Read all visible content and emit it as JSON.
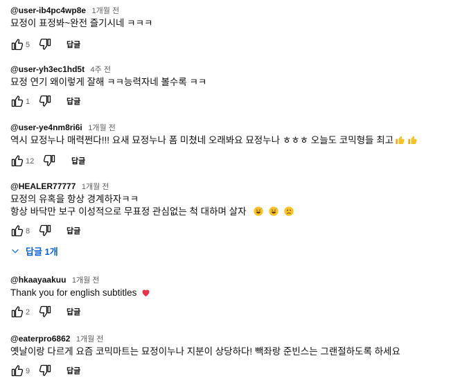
{
  "comments": [
    {
      "author": "@user-ib4pc4wp8e",
      "time": "1개월 전",
      "lines": [
        "묘정이 표정봐~완전 즐기시네 ㅋㅋㅋ"
      ],
      "likes": "5",
      "reply_label": "답글"
    },
    {
      "author": "@user-yh3ec1hd5t",
      "time": "4주 전",
      "lines": [
        "묘정 연기 왜이렇게 잘해 ㅋㅋ능력자네 볼수록 ㅋㅋ"
      ],
      "likes": "1",
      "reply_label": "답글"
    },
    {
      "author": "@user-ye4nm8ri6i",
      "time": "1개월 전",
      "lines": [
        "역시 묘정누나 매력쩐다!!! 요새 묘정누나 폼 미쳤네 오래봐요 묘정누나 ㅎㅎㅎ 오늘도 코믹형들 최고"
      ],
      "emojis": [
        "thumbs-up-emoji",
        "thumbs-up-emoji"
      ],
      "likes": "12",
      "reply_label": "답글"
    },
    {
      "author": "@HEALER77777",
      "time": "1개월 전",
      "lines": [
        "묘정의 유혹을 항상 경계하자ㅋㅋ",
        "항상 바닥만 보구 이성적으로 무표정 관심없는 척 대하며 살자"
      ],
      "emojis": [
        "grinning-sweat-emoji",
        "grinning-sweat-emoji",
        "sad-face-emoji"
      ],
      "likes": "8",
      "reply_label": "답글"
    },
    {
      "author": "@hkaayaakuu",
      "time": "1개월 전",
      "lines": [
        "Thank you for english subtitles"
      ],
      "emojis": [
        "red-heart-emoji"
      ],
      "likes": "2",
      "reply_label": "답글"
    },
    {
      "author": "@eaterpro6862",
      "time": "1개월 전",
      "lines": [
        "옛날이랑 다르게 요즘 코믹마트는 묘정이누나 지분이 상당하다! 빽좌랑 준빈스는 그랜절하도록 하세요"
      ],
      "likes": "9",
      "reply_label": "답글"
    }
  ],
  "replies_toggle": {
    "label": "답글 1개",
    "icon": "chevron-down-icon"
  },
  "colors": {
    "author": "#0f0f0f",
    "meta": "#606060",
    "link": "#065fd4",
    "emoji_yellow": "#f7c325",
    "heart": "#e8334a"
  },
  "icons": {
    "like": "thumbs-up-outline-icon",
    "dislike": "thumbs-down-outline-icon"
  }
}
